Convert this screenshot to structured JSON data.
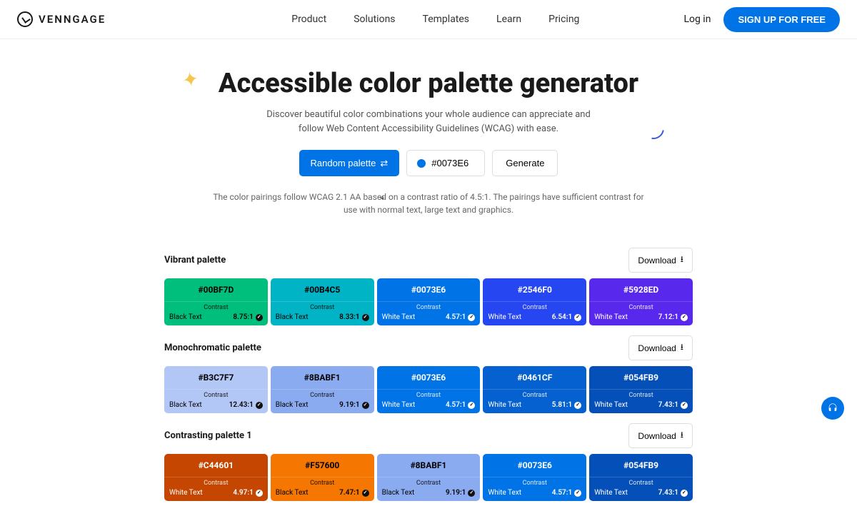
{
  "brand": "VENNGAGE",
  "nav": {
    "product": "Product",
    "solutions": "Solutions",
    "templates": "Templates",
    "learn": "Learn",
    "pricing": "Pricing"
  },
  "auth": {
    "login": "Log in",
    "signup": "SIGN UP FOR FREE"
  },
  "hero": {
    "title": "Accessible color palette generator",
    "subtitle1": "Discover beautiful color combinations your whole audience can appreciate and",
    "subtitle2": "follow Web Content Accessibility Guidelines (WCAG) with ease.",
    "random": "Random palette",
    "color_value": "#0073E6",
    "generate": "Generate",
    "disclaimer": "The color pairings follow WCAG 2.1 AA based on a contrast ratio of 4.5:1. The pairings have sufficient contrast for use with normal text, large text and graphics."
  },
  "download_label": "Download",
  "contrast_label": "Contrast",
  "black_text_label": "Black Text",
  "white_text_label": "White Text",
  "palettes": [
    {
      "name": "Vibrant palette",
      "colors": [
        {
          "hex": "#00BF7D",
          "bg": "#00BF7D",
          "text": "black",
          "ratio": "8.75:1"
        },
        {
          "hex": "#00B4C5",
          "bg": "#00B4C5",
          "text": "black",
          "ratio": "8.33:1"
        },
        {
          "hex": "#0073E6",
          "bg": "#0073E6",
          "text": "white",
          "ratio": "4.57:1"
        },
        {
          "hex": "#2546F0",
          "bg": "#2546F0",
          "text": "white",
          "ratio": "6.54:1"
        },
        {
          "hex": "#5928ED",
          "bg": "#5928ED",
          "text": "white",
          "ratio": "7.12:1"
        }
      ]
    },
    {
      "name": "Monochromatic palette",
      "colors": [
        {
          "hex": "#B3C7F7",
          "bg": "#B3C7F7",
          "text": "black",
          "ratio": "12.43:1"
        },
        {
          "hex": "#8BABF1",
          "bg": "#8BABF1",
          "text": "black",
          "ratio": "9.19:1"
        },
        {
          "hex": "#0073E6",
          "bg": "#0073E6",
          "text": "white",
          "ratio": "4.57:1"
        },
        {
          "hex": "#0461CF",
          "bg": "#0461CF",
          "text": "white",
          "ratio": "5.81:1"
        },
        {
          "hex": "#054FB9",
          "bg": "#054FB9",
          "text": "white",
          "ratio": "7.43:1"
        }
      ]
    },
    {
      "name": "Contrasting palette 1",
      "colors": [
        {
          "hex": "#C44601",
          "bg": "#C44601",
          "text": "white",
          "ratio": "4.97:1"
        },
        {
          "hex": "#F57600",
          "bg": "#F57600",
          "text": "black",
          "ratio": "7.47:1"
        },
        {
          "hex": "#8BABF1",
          "bg": "#8BABF1",
          "text": "black",
          "ratio": "9.19:1"
        },
        {
          "hex": "#0073E6",
          "bg": "#0073E6",
          "text": "white",
          "ratio": "4.57:1"
        },
        {
          "hex": "#054FB9",
          "bg": "#054FB9",
          "text": "white",
          "ratio": "7.43:1"
        }
      ]
    }
  ]
}
